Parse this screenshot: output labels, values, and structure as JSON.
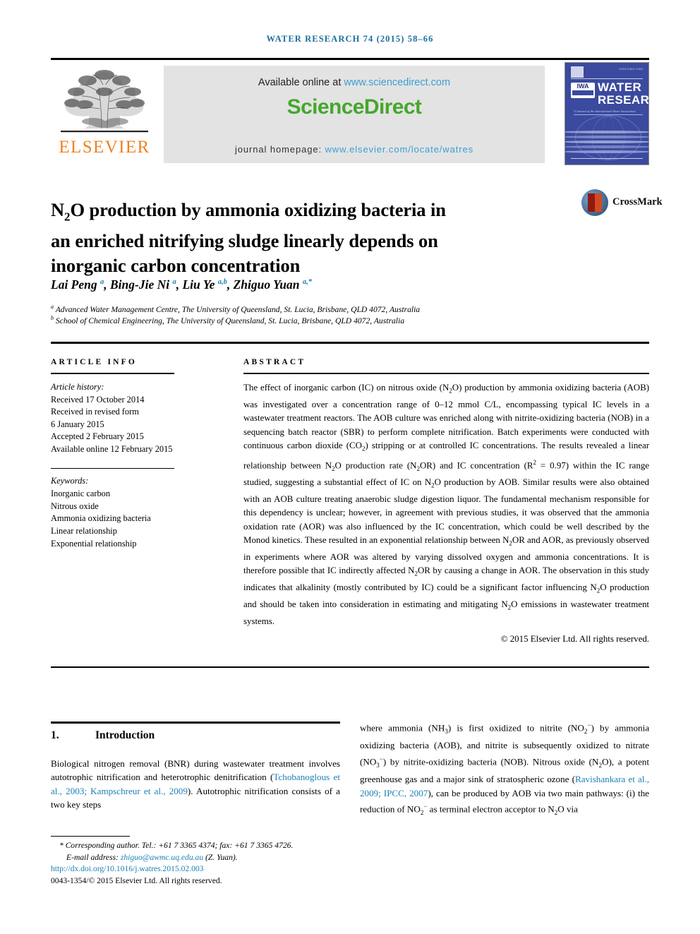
{
  "running_head": "WATER RESEARCH 74 (2015) 58–66",
  "masthead": {
    "available_prefix": "Available online at ",
    "sciencedirect_url": "www.sciencedirect.com",
    "sciencedirect_logo": "ScienceDirect",
    "journal_homepage_label": "journal homepage: ",
    "journal_homepage_url": "www.elsevier.com/locate/watres",
    "publisher": "ELSEVIER",
    "cover": {
      "title_line1": "WATER",
      "title_line2": "RESEARCH",
      "society": "IWA",
      "subtitle": "A Journal of the International Water Association",
      "issn": "ISSN 0043-1354"
    }
  },
  "crossmark": {
    "label": "CrossMark"
  },
  "article": {
    "title_line1_pre": "N",
    "title_line1_sub": "2",
    "title_line1_post": "O production by ammonia oxidizing bacteria in",
    "title_line2": "an enriched nitrifying sludge linearly depends on",
    "title_line3": "inorganic carbon concentration",
    "authors": [
      {
        "name": "Lai Peng",
        "marks": "a"
      },
      {
        "name": "Bing-Jie Ni",
        "marks": "a"
      },
      {
        "name": "Liu Ye",
        "marks": "a,b"
      },
      {
        "name": "Zhiguo Yuan",
        "marks": "a,*"
      }
    ],
    "affiliations": [
      {
        "mark": "a",
        "text": "Advanced Water Management Centre, The University of Queensland, St. Lucia, Brisbane, QLD 4072, Australia"
      },
      {
        "mark": "b",
        "text": "School of Chemical Engineering, The University of Queensland, St. Lucia, Brisbane, QLD 4072, Australia"
      }
    ]
  },
  "article_info": {
    "heading": "ARTICLE INFO",
    "history_label": "Article history:",
    "history": [
      "Received 17 October 2014",
      "Received in revised form",
      "6 January 2015",
      "Accepted 2 February 2015",
      "Available online 12 February 2015"
    ],
    "keywords_label": "Keywords:",
    "keywords": [
      "Inorganic carbon",
      "Nitrous oxide",
      "Ammonia oxidizing bacteria",
      "Linear relationship",
      "Exponential relationship"
    ]
  },
  "abstract": {
    "heading": "ABSTRACT",
    "copyright": "© 2015 Elsevier Ltd. All rights reserved."
  },
  "introduction": {
    "number": "1.",
    "title": "Introduction"
  },
  "footnote": {
    "corresponding": "* Corresponding author. Tel.: +61 7 3365 4374; fax: +61 7 3365 4726.",
    "email_label": "E-mail address: ",
    "email": "zhiguo@awmc.uq.edu.au",
    "email_suffix": " (Z. Yuan).",
    "doi": "http://dx.doi.org/10.1016/j.watres.2015.02.003",
    "issn_line": "0043-1354/© 2015 Elsevier Ltd. All rights reserved."
  },
  "colors": {
    "link": "#1a7fb5",
    "sciencedirect_green": "#45a72c",
    "elsevier_orange": "#f08122",
    "cover_blue": "#3b4a9e",
    "running_head": "#1a6e9e"
  }
}
